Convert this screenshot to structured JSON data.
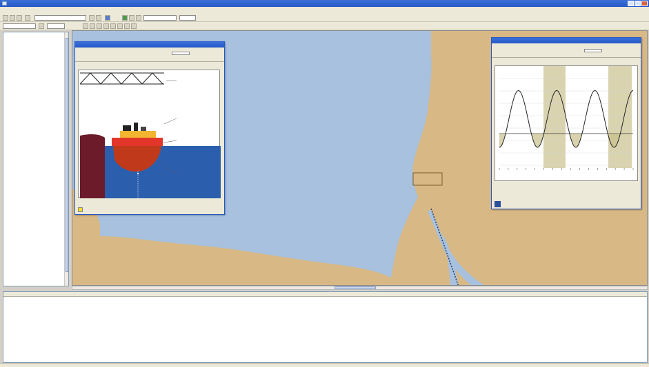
{
  "window": {
    "title": ""
  },
  "menu": [],
  "toolbar": {},
  "tree": {
    "root_label": "",
    "items": []
  },
  "map": {
    "caption": "",
    "place_labels": []
  },
  "tide_window": {
    "title": "",
    "time_label": "",
    "date_label": "",
    "chart_title": "",
    "height_label": "",
    "footnote": "",
    "tabs": [],
    "buttons": []
  },
  "clearance_window": {
    "title": "",
    "time_label": "",
    "date_label": "",
    "under_keel_label": "",
    "air_draught_label": "",
    "labels": {
      "bridge": "",
      "height": "",
      "draught": "",
      "clearance": "",
      "depth": ""
    },
    "footnote": "",
    "tabs": [],
    "buttons": []
  },
  "list": {
    "columns": [],
    "rows": []
  },
  "status": {
    "left": "",
    "mid": "",
    "right": ""
  },
  "colors": {
    "water": "#a7c1de",
    "land": "#d8b884",
    "titlebar": "#2458c8",
    "hull": "#c0391b",
    "deck": "#f2b531"
  },
  "chart_data": {
    "type": "line",
    "title": "",
    "xlabel": "",
    "ylabel": "",
    "series": [
      {
        "name": "",
        "values": [
          0.2,
          0.95,
          0.2,
          0.95,
          0.2,
          0.95,
          0.2,
          0.95
        ]
      }
    ]
  }
}
